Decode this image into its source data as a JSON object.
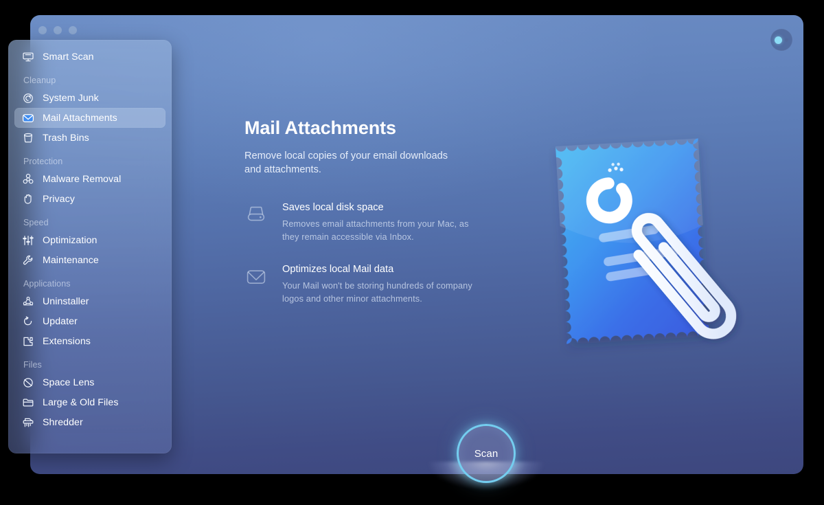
{
  "window": {
    "traffic_lights": [
      "close",
      "minimize",
      "zoom"
    ],
    "assistant_button": "assistant-indicator"
  },
  "sidebar": {
    "groups": [
      {
        "label": "",
        "items": [
          {
            "label": "Smart Scan",
            "icon": "monitor-icon",
            "selected": false
          }
        ]
      },
      {
        "label": "Cleanup",
        "items": [
          {
            "label": "System Junk",
            "icon": "snail-icon",
            "selected": false
          },
          {
            "label": "Mail Attachments",
            "icon": "envelope-icon",
            "selected": true
          },
          {
            "label": "Trash Bins",
            "icon": "trash-bin-icon",
            "selected": false
          }
        ]
      },
      {
        "label": "Protection",
        "items": [
          {
            "label": "Malware Removal",
            "icon": "biohazard-icon",
            "selected": false
          },
          {
            "label": "Privacy",
            "icon": "hand-icon",
            "selected": false
          }
        ]
      },
      {
        "label": "Speed",
        "items": [
          {
            "label": "Optimization",
            "icon": "sliders-icon",
            "selected": false
          },
          {
            "label": "Maintenance",
            "icon": "wrench-icon",
            "selected": false
          }
        ]
      },
      {
        "label": "Applications",
        "items": [
          {
            "label": "Uninstaller",
            "icon": "molecule-icon",
            "selected": false
          },
          {
            "label": "Updater",
            "icon": "refresh-arrow-icon",
            "selected": false
          },
          {
            "label": "Extensions",
            "icon": "puzzle-piece-icon",
            "selected": false
          }
        ]
      },
      {
        "label": "Files",
        "items": [
          {
            "label": "Space Lens",
            "icon": "planet-icon",
            "selected": false
          },
          {
            "label": "Large & Old Files",
            "icon": "folder-icon",
            "selected": false
          },
          {
            "label": "Shredder",
            "icon": "shredder-icon",
            "selected": false
          }
        ]
      }
    ]
  },
  "main": {
    "title": "Mail Attachments",
    "description": "Remove local copies of your email downloads and attachments.",
    "features": [
      {
        "icon": "hard-drive-icon",
        "title": "Saves local disk space",
        "description": "Removes email attachments from your Mac, as they remain accessible via Inbox."
      },
      {
        "icon": "envelope-icon",
        "title": "Optimizes local Mail data",
        "description": "Your Mail won't be storing hundreds of company logos and other minor attachments."
      }
    ],
    "illustration": "postage-stamp-with-paperclip-illustration"
  },
  "action": {
    "scan_label": "Scan"
  },
  "colors": {
    "accent_cyan": "#74cdef",
    "window_top": "#6b8cc4",
    "window_bottom": "#3d477e",
    "stamp_blue": "#3f8ef0",
    "text_primary": "#ffffff"
  }
}
